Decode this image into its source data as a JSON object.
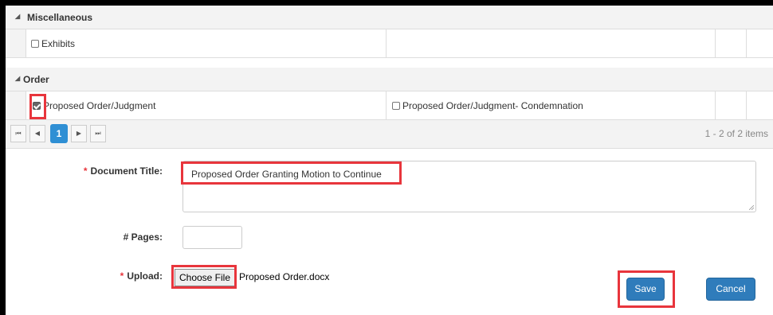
{
  "groups": {
    "misc": {
      "label": "Miscellaneous"
    },
    "order": {
      "label": "Order"
    }
  },
  "rows": {
    "exhibits": {
      "label": "Exhibits",
      "checked": false
    },
    "proposed_order": {
      "label": "Proposed Order/Judgment",
      "checked": true
    },
    "proposed_condemnation": {
      "label": "Proposed Order/Judgment- Condemnation",
      "checked": false
    }
  },
  "pager": {
    "first": "⏮",
    "prev": "◀",
    "current": "1",
    "next": "▶",
    "last": "⏭",
    "info": "1 - 2 of 2 items"
  },
  "form": {
    "required_mark": "*",
    "document_title_label": "Document Title:",
    "document_title_value": "Proposed Order Granting Motion to Continue",
    "pages_label": "# Pages:",
    "pages_value": "",
    "upload_label": "Upload:",
    "choose_file": "Choose File",
    "file_name": "Proposed Order.docx"
  },
  "buttons": {
    "save": "Save",
    "cancel": "Cancel"
  },
  "colors": {
    "highlight": "#e8353c",
    "primary": "#2f7cbb",
    "pager_active": "#2f8fd4"
  }
}
